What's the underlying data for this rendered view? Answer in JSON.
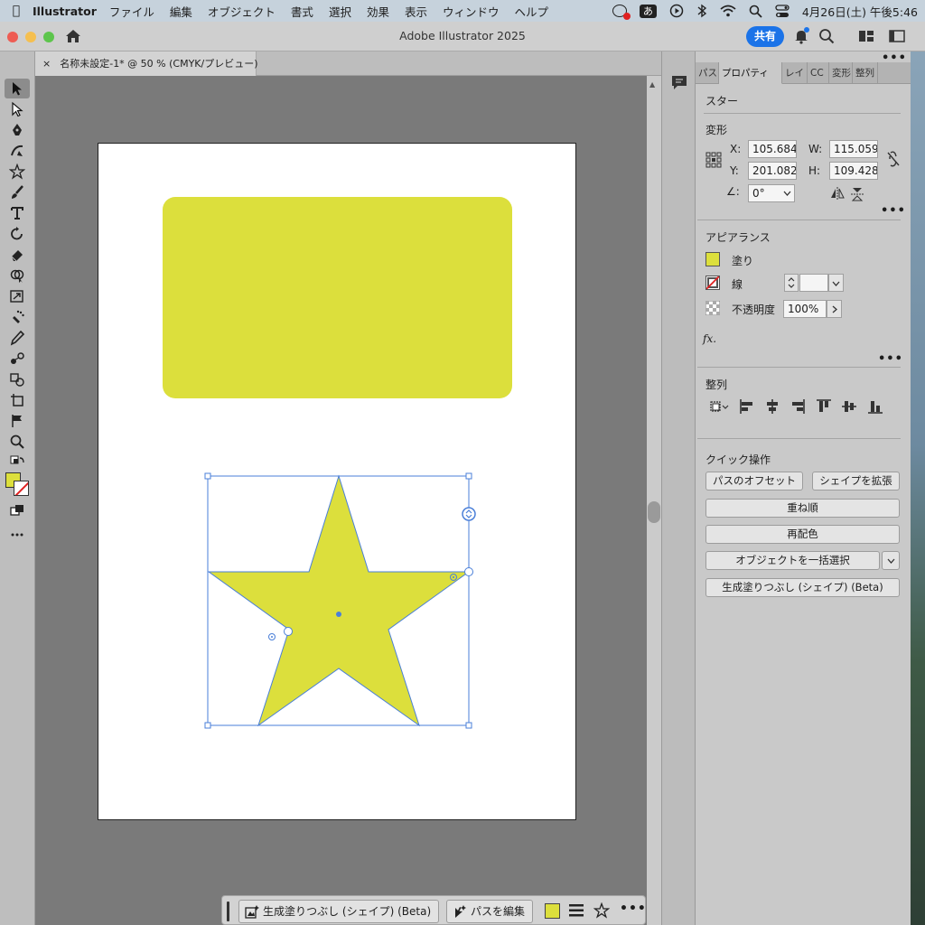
{
  "menubar": {
    "app": "Illustrator",
    "items": [
      "ファイル",
      "編集",
      "オブジェクト",
      "書式",
      "選択",
      "効果",
      "表示",
      "ウィンドウ",
      "ヘルプ"
    ],
    "ime": "あ",
    "clock": "4月26日(土) 午後5:46"
  },
  "window": {
    "title": "Adobe Illustrator 2025",
    "share_label": "共有"
  },
  "document": {
    "tab_close": "×",
    "tab_title": "名称未設定-1* @ 50 % (CMYK/プレビュー)"
  },
  "colors": {
    "fill": "#dcdf3c",
    "selection": "#4a7fd8",
    "accent": "#1b73e8"
  },
  "taskbar": {
    "generative_fill": "生成塗りつぶし (シェイプ) (Beta)",
    "edit_path": "パスを編集",
    "more": "•••"
  },
  "panel_tabs": [
    "パス",
    "プロパティ",
    "レイ",
    "CC",
    "変形",
    "整列"
  ],
  "properties": {
    "object_type": "スター",
    "transform": {
      "title": "変形",
      "x_label": "X:",
      "x_value": "105.684",
      "y_label": "Y:",
      "y_value": "201.082",
      "w_label": "W:",
      "w_value": "115.059",
      "h_label": "H:",
      "h_value": "109.428",
      "angle_label": "∠:",
      "angle_value": "0°"
    },
    "appearance": {
      "title": "アピアランス",
      "fill_label": "塗り",
      "stroke_label": "線",
      "opacity_label": "不透明度",
      "opacity_value": "100%",
      "fx_label": "fx."
    },
    "align": {
      "title": "整列"
    },
    "quick_actions": {
      "title": "クイック操作",
      "offset_path": "パスのオフセット",
      "expand_shape": "シェイプを拡張",
      "arrange": "重ね順",
      "recolor": "再配色",
      "select_same": "オブジェクトを一括選択",
      "generative_fill": "生成塗りつぶし (シェイプ) (Beta)"
    },
    "more": "•••"
  }
}
